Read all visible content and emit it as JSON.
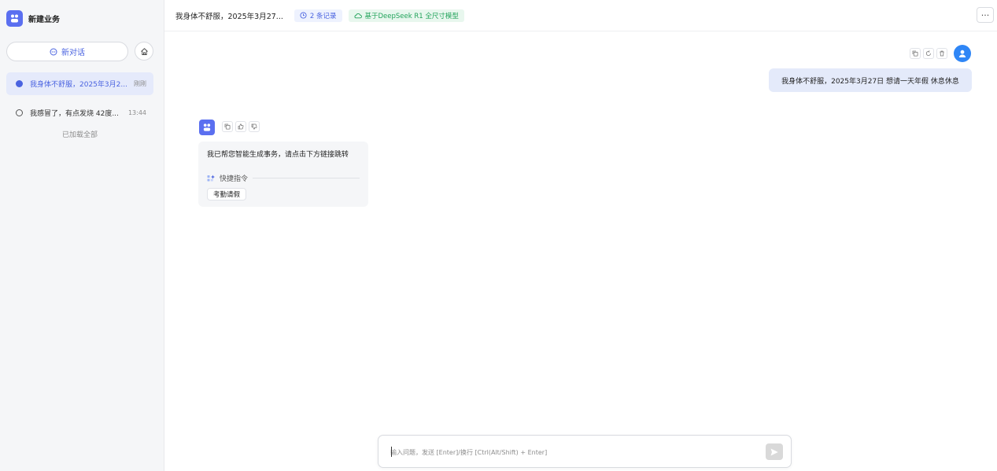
{
  "sidebar": {
    "brand_name": "新建业务",
    "new_chat_label": "新对话",
    "conversations": [
      {
        "title": "我身体不舒服，2025年3月2...",
        "time": "刚刚",
        "active": true
      },
      {
        "title": "我感冒了，有点发烧 42度...",
        "time": "13:44",
        "active": false
      }
    ],
    "loaded_all_text": "已加载全部"
  },
  "header": {
    "title": "我身体不舒服，2025年3月27...",
    "records_tag": "2 条记录",
    "model_tag": "基于DeepSeek R1 全尺寸模型",
    "more_label": "···"
  },
  "chat": {
    "user_message": "我身体不舒服，2025年3月27日 想请一天年假 休息休息",
    "bot_message": "我已帮您智能生成事务，请点击下方链接跳转",
    "quick_commands_label": "快捷指令",
    "quick_chip": "考勤请假"
  },
  "input": {
    "placeholder": "输入问题，发送 [Enter]/换行 [Ctrl(Alt/Shift) + Enter]"
  },
  "icons": {
    "brand": "bot-logo-icon",
    "new_chat": "chat-bubble-icon",
    "sidebar_action": "house-icon",
    "records": "clock-icon",
    "model": "cloud-icon",
    "copy": "copy-icon",
    "regenerate": "refresh-icon",
    "delete": "trash-icon",
    "like": "thumbs-up-icon",
    "dislike": "thumbs-down-icon",
    "user": "user-avatar-icon",
    "quick": "sparkle-icon",
    "send": "send-icon"
  },
  "colors": {
    "accent": "#4a63e0",
    "brand": "#5b6ff0",
    "model_tag": "#22a35b",
    "user_bubble": "#e4eafa",
    "user_avatar": "#2f86f6"
  }
}
